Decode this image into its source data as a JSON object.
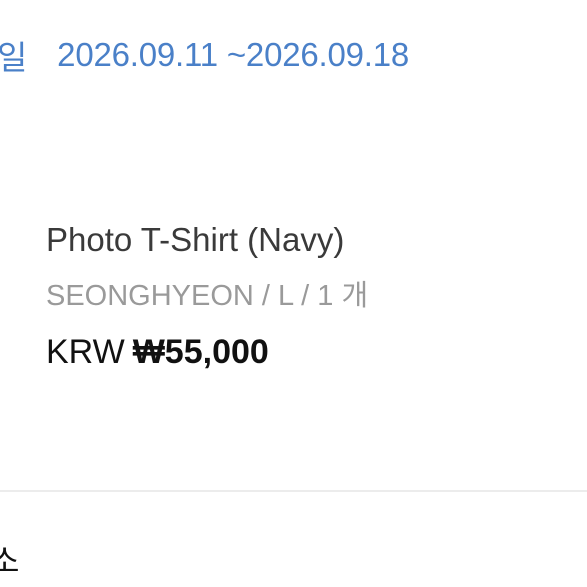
{
  "period": {
    "label": "일",
    "value": "2026.09.11 ~2026.09.18"
  },
  "product": {
    "name": "Photo T-Shirt (Navy)",
    "options": "SEONGHYEON / L / 1 개",
    "price_currency": "KRW",
    "price_amount": "₩55,000"
  },
  "next_section": {
    "label": "소"
  },
  "colors": {
    "accent": "#4a80c8",
    "text_primary": "#111111",
    "text_secondary": "#9a9a9a",
    "divider": "#ececec"
  }
}
